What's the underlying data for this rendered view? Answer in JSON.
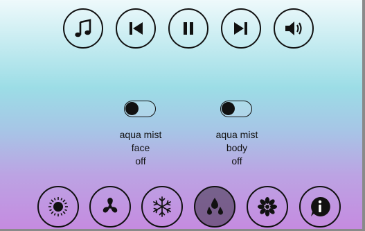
{
  "top_controls": [
    {
      "icon": "music-note-icon"
    },
    {
      "icon": "skip-previous-icon"
    },
    {
      "icon": "pause-icon"
    },
    {
      "icon": "skip-next-icon"
    },
    {
      "icon": "volume-icon"
    }
  ],
  "mists": [
    {
      "line1": "aqua mist",
      "line2": "face",
      "state": "off",
      "enabled": false
    },
    {
      "line1": "aqua mist",
      "line2": "body",
      "state": "off",
      "enabled": false
    }
  ],
  "bottom_modes": [
    {
      "icon": "sun-icon",
      "active": false
    },
    {
      "icon": "fan-icon",
      "active": false
    },
    {
      "icon": "snowflake-icon",
      "active": false
    },
    {
      "icon": "water-drops-icon",
      "active": true
    },
    {
      "icon": "flower-icon",
      "active": false
    },
    {
      "icon": "info-icon",
      "active": false
    }
  ],
  "colors": {
    "bg_top": "#eef9fb",
    "bg_mid": "#9cdde6",
    "bg_bottom": "#c58ae0",
    "active_button": "#5a4b63"
  }
}
